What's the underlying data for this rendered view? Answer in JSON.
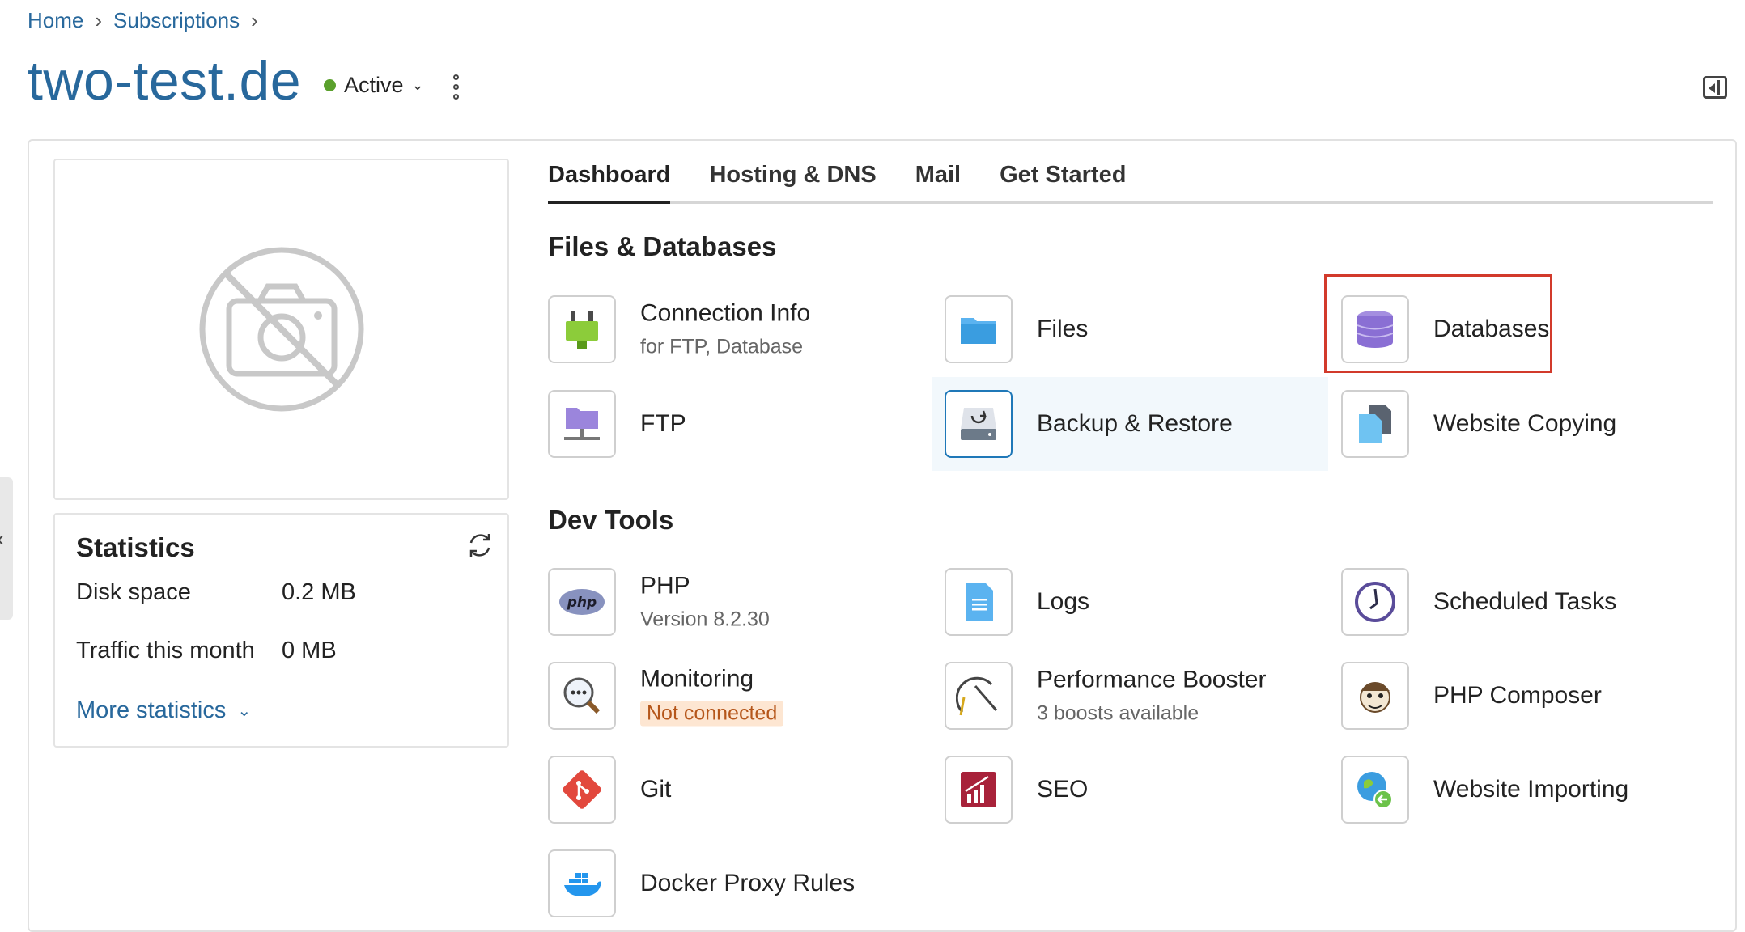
{
  "breadcrumb": {
    "home": "Home",
    "subscriptions": "Subscriptions"
  },
  "page": {
    "title": "two-test.de",
    "status": "Active"
  },
  "statistics": {
    "title": "Statistics",
    "disk_label": "Disk space",
    "disk_value": "0.2 MB",
    "traffic_label": "Traffic this month",
    "traffic_value": "0 MB",
    "more": "More statistics"
  },
  "tabs": [
    "Dashboard",
    "Hosting & DNS",
    "Mail",
    "Get Started"
  ],
  "sections": {
    "files": {
      "title": "Files & Databases",
      "items": [
        {
          "title": "Connection Info",
          "sub": "for FTP, Database",
          "icon": "plug-icon"
        },
        {
          "title": "Files",
          "icon": "folder-icon"
        },
        {
          "title": "Databases",
          "icon": "database-icon"
        },
        {
          "title": "FTP",
          "icon": "ftp-icon"
        },
        {
          "title": "Backup & Restore",
          "icon": "backup-icon"
        },
        {
          "title": "Website Copying",
          "icon": "copy-icon"
        }
      ]
    },
    "dev": {
      "title": "Dev Tools",
      "items": [
        {
          "title": "PHP",
          "sub": "Version 8.2.30",
          "icon": "php-icon"
        },
        {
          "title": "Logs",
          "icon": "logs-icon"
        },
        {
          "title": "Scheduled Tasks",
          "icon": "clock-icon"
        },
        {
          "title": "Monitoring",
          "sub": "Not connected",
          "icon": "monitoring-icon"
        },
        {
          "title": "Performance Booster",
          "sub": "3 boosts available",
          "icon": "gauge-icon"
        },
        {
          "title": "PHP Composer",
          "icon": "composer-icon"
        },
        {
          "title": "Git",
          "icon": "git-icon"
        },
        {
          "title": "SEO",
          "icon": "seo-icon"
        },
        {
          "title": "Website Importing",
          "icon": "globe-import-icon"
        },
        {
          "title": "Docker Proxy Rules",
          "icon": "docker-icon"
        }
      ]
    }
  },
  "colors": {
    "link": "#28689c",
    "status_active": "#5aa02c",
    "highlight": "#d23a2b",
    "warn_bg": "#fde6d2"
  }
}
